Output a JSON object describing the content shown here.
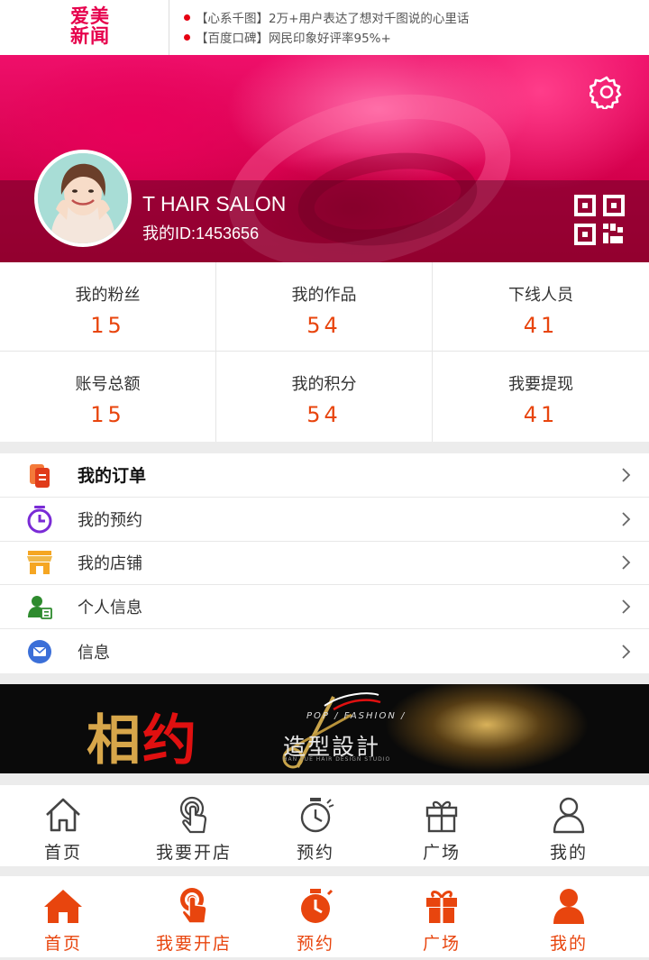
{
  "header": {
    "logo_line1": "爱美",
    "logo_line2": "新闻",
    "news": [
      {
        "tag": "【心系千图】",
        "text": "2万+用户表达了想对千图说的心里话"
      },
      {
        "tag": "【百度口碑】",
        "text": "网民印象好评率95%+"
      }
    ]
  },
  "profile": {
    "name": "T HAIR SALON",
    "id_text": "我的ID:1453656",
    "icons": [
      "settings-icon",
      "qr-code-icon"
    ]
  },
  "stats": [
    {
      "label": "我的粉丝",
      "value": "15"
    },
    {
      "label": "我的作品",
      "value": "54"
    },
    {
      "label": "下线人员",
      "value": "41"
    },
    {
      "label": "账号总额",
      "value": "15"
    },
    {
      "label": "我的积分",
      "value": "54"
    },
    {
      "label": "我要提现",
      "value": "41"
    }
  ],
  "menu": [
    {
      "label": "我的订单",
      "icon": "orders-icon",
      "color": "#e8450e"
    },
    {
      "label": "我的预约",
      "icon": "appointment-icon",
      "color": "#7a2bd6"
    },
    {
      "label": "我的店铺",
      "icon": "shop-icon",
      "color": "#f5a623"
    },
    {
      "label": "个人信息",
      "icon": "user-info-icon",
      "color": "#2e8b2e"
    },
    {
      "label": "信息",
      "icon": "message-icon",
      "color": "#3b6fd8"
    }
  ],
  "banner": {
    "main_a": "相",
    "main_b": "约",
    "sub": "造型設計",
    "slogan": "POP / FASHION /",
    "studio": "HAN YUE HAIR DESIGN STUDIO"
  },
  "tabbar_gray": {
    "color": "#333333",
    "tabs": [
      {
        "label": "首页",
        "icon": "home-icon"
      },
      {
        "label": "我要开店",
        "icon": "tap-hand-icon"
      },
      {
        "label": "预约",
        "icon": "stopwatch-icon"
      },
      {
        "label": "广场",
        "icon": "gift-icon"
      },
      {
        "label": "我的",
        "icon": "person-icon"
      }
    ]
  },
  "tabbar_orange": {
    "color": "#e8450e",
    "tabs": [
      {
        "label": "首页",
        "icon": "home-icon"
      },
      {
        "label": "我要开店",
        "icon": "tap-hand-icon"
      },
      {
        "label": "预约",
        "icon": "stopwatch-icon"
      },
      {
        "label": "广场",
        "icon": "gift-icon"
      },
      {
        "label": "我的",
        "icon": "person-icon"
      }
    ]
  }
}
